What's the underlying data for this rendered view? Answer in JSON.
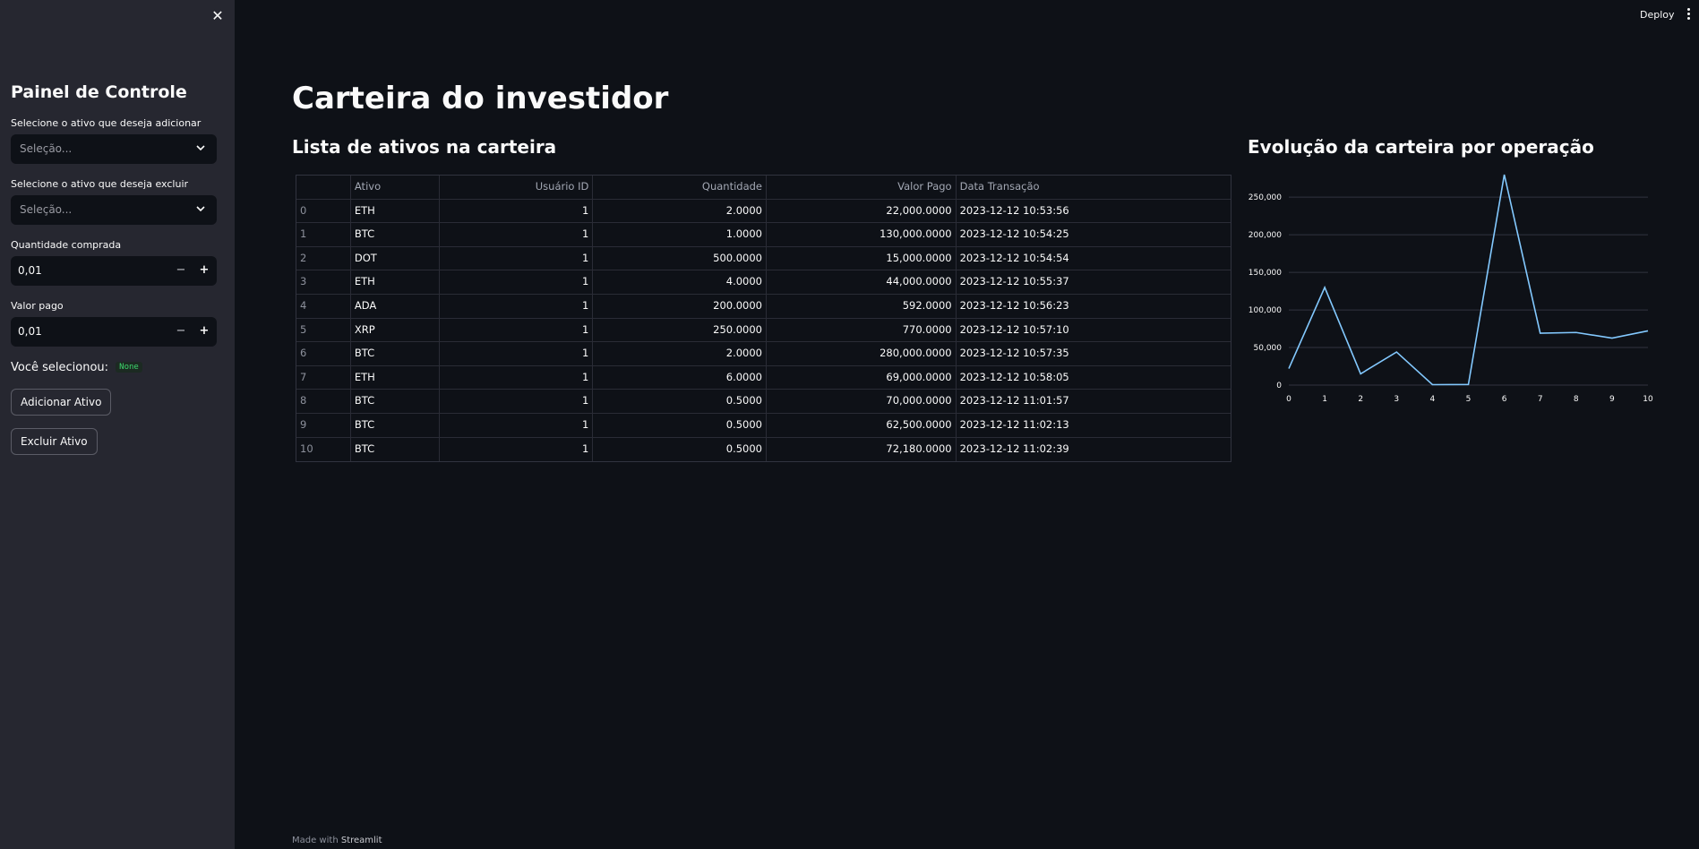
{
  "sidebar": {
    "title": "Painel de Controle",
    "add_select_label": "Selecione o ativo que deseja adicionar",
    "add_select_placeholder": "Seleção...",
    "remove_select_label": "Selecione o ativo que deseja excluir",
    "remove_select_placeholder": "Seleção...",
    "qty_label": "Quantidade comprada",
    "qty_value": "0,01",
    "price_label": "Valor pago",
    "price_value": "0,01",
    "minus": "−",
    "plus": "+",
    "selected_text": "Você selecionou:",
    "selected_value": "None",
    "add_button": "Adicionar Ativo",
    "remove_button": "Excluir Ativo",
    "close": "✕"
  },
  "header": {
    "deploy": "Deploy"
  },
  "main": {
    "title": "Carteira do investidor",
    "table_title": "Lista de ativos na carteira",
    "chart_title": "Evolução da carteira por operação"
  },
  "table": {
    "columns": [
      "",
      "Ativo",
      "Usuário ID",
      "Quantidade",
      "Valor Pago",
      "Data Transação"
    ],
    "rows": [
      [
        "0",
        "ETH",
        "1",
        "2.0000",
        "22,000.0000",
        "2023-12-12 10:53:56"
      ],
      [
        "1",
        "BTC",
        "1",
        "1.0000",
        "130,000.0000",
        "2023-12-12 10:54:25"
      ],
      [
        "2",
        "DOT",
        "1",
        "500.0000",
        "15,000.0000",
        "2023-12-12 10:54:54"
      ],
      [
        "3",
        "ETH",
        "1",
        "4.0000",
        "44,000.0000",
        "2023-12-12 10:55:37"
      ],
      [
        "4",
        "ADA",
        "1",
        "200.0000",
        "592.0000",
        "2023-12-12 10:56:23"
      ],
      [
        "5",
        "XRP",
        "1",
        "250.0000",
        "770.0000",
        "2023-12-12 10:57:10"
      ],
      [
        "6",
        "BTC",
        "1",
        "2.0000",
        "280,000.0000",
        "2023-12-12 10:57:35"
      ],
      [
        "7",
        "ETH",
        "1",
        "6.0000",
        "69,000.0000",
        "2023-12-12 10:58:05"
      ],
      [
        "8",
        "BTC",
        "1",
        "0.5000",
        "70,000.0000",
        "2023-12-12 11:01:57"
      ],
      [
        "9",
        "BTC",
        "1",
        "0.5000",
        "62,500.0000",
        "2023-12-12 11:02:13"
      ],
      [
        "10",
        "BTC",
        "1",
        "0.5000",
        "72,180.0000",
        "2023-12-12 11:02:39"
      ]
    ]
  },
  "chart_data": {
    "type": "line",
    "x": [
      0,
      1,
      2,
      3,
      4,
      5,
      6,
      7,
      8,
      9,
      10
    ],
    "series": [
      {
        "values": [
          22000,
          130000,
          15000,
          44000,
          592,
          770,
          280000,
          69000,
          70000,
          62500,
          72180
        ]
      }
    ],
    "x_ticks": [
      "0",
      "1",
      "2",
      "3",
      "4",
      "5",
      "6",
      "7",
      "8",
      "9",
      "10"
    ],
    "y_ticks": [
      0,
      50000,
      100000,
      150000,
      200000,
      250000
    ],
    "y_tick_labels": [
      "0",
      "50,000",
      "100,000",
      "150,000",
      "200,000",
      "250,000"
    ],
    "xlim": [
      0,
      10
    ],
    "ylim": [
      0,
      280000
    ],
    "grid": true,
    "line_color": "#83c9ff",
    "grid_color": "#31333f"
  },
  "footer": {
    "prefix": "Made with ",
    "brand": "Streamlit"
  }
}
